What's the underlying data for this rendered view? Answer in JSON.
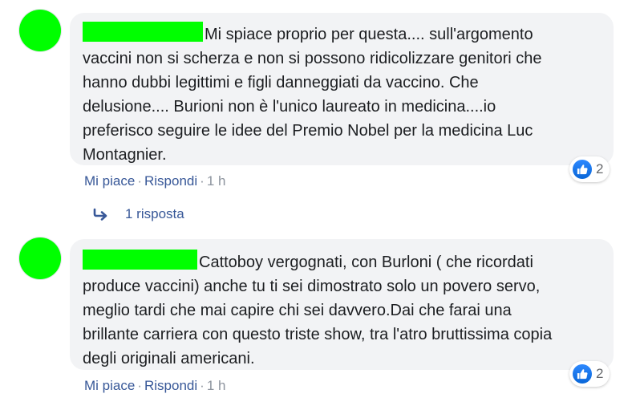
{
  "comments": [
    {
      "author": "",
      "text_first": "Mi spiace proprio per questa.... sull'argomento",
      "text_rest": "vaccini non si scherza e non si possono ridicolizzare genitori che\nhanno dubbi legittimi e figli danneggiati da vaccino. Che\ndelusione.... Burioni non è l'unico laureato in medicina....io\npreferisco seguire le idee del Premio Nobel per la medicina Luc\nMontagnier.",
      "like_label": "Mi piace",
      "reply_label": "Rispondi",
      "time": "1 h",
      "reaction_count": "2",
      "reaction_icon": "like-icon"
    },
    {
      "author": "",
      "text_first": "Cattoboy vergognati, con Burloni ( che ricordati",
      "text_rest": "produce vaccini) anche tu ti sei dimostrato solo un povero servo,\nmeglio tardi che mai capire chi sei davvero.Dai che farai una\nbrillante carriera con questo triste show, tra l'atro bruttissima copia\ndegli originali americani.",
      "like_label": "Mi piace",
      "reply_label": "Rispondi",
      "time": "1 h",
      "reaction_count": "2",
      "reaction_icon": "like-icon"
    }
  ],
  "replies_link": "1 risposta",
  "separator": "·",
  "colors": {
    "bubble": "#f2f3f5",
    "link": "#385898",
    "redaction": "#00ff00",
    "like_blue": "#1877f2"
  }
}
